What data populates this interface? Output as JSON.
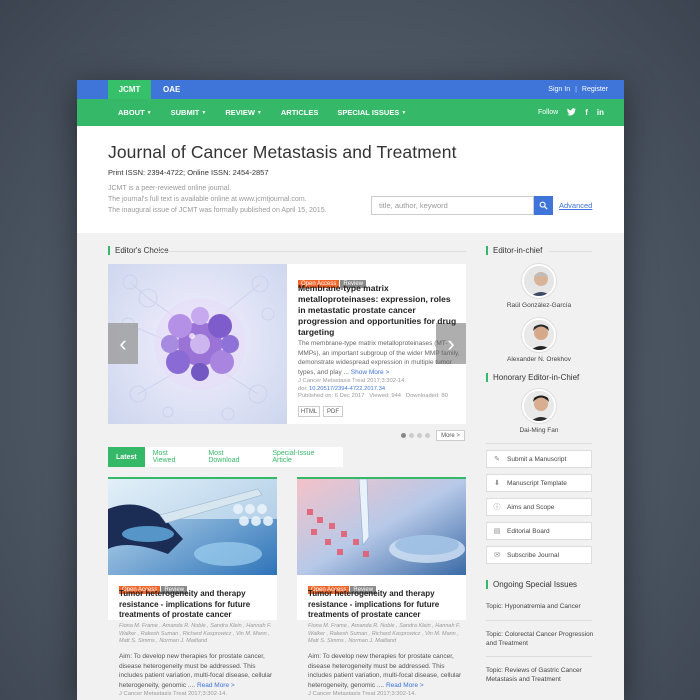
{
  "topbar": {
    "brand": "JCMT",
    "oae": "OAE",
    "signin": "Sign In",
    "sep": "|",
    "register": "Register"
  },
  "nav": {
    "items": [
      {
        "label": "ABOUT",
        "caret": true
      },
      {
        "label": "SUBMIT",
        "caret": true
      },
      {
        "label": "REVIEW",
        "caret": true
      },
      {
        "label": "ARTICLES",
        "caret": false
      },
      {
        "label": "SPECIAL ISSUES",
        "caret": true
      }
    ],
    "follow": "Follow"
  },
  "header": {
    "title": "Journal of Cancer Metastasis and Treatment",
    "issn": "Print ISSN: 2394-4722; Online ISSN: 2454-2857",
    "desc_lines": [
      "JCMT is a peer-reviewed online journal.",
      "The journal's full text is available online at www.jcmtjournal.com.",
      "The inaugural issue of JCMT was formally published on April 15, 2015."
    ],
    "search_placeholder": "title, author, keyword",
    "advanced": "Advanced"
  },
  "editors_choice": {
    "heading": "Editor's Choice",
    "tag_oa": "Open Access",
    "tag_review": "Review",
    "title": "Membrane-type matrix metalloproteinases: expression, roles in metastatic prostate cancer progression and opportunities for drug targeting",
    "abstract": "The membrane-type matrix metalloproteinases (MT-MMPs), an important subgroup of the wider MMP family, demonstrate widespread expression in multiple tumor types, and play ...",
    "show_more": "Show More >",
    "citation": "J Cancer Metastasis Treat 2017;3:302-14.",
    "doi_label": "doi:",
    "doi": "10.20517/2394-4722.2017.34",
    "published": "Published on: 6 Dec 2017",
    "viewed": "Viewed: 944",
    "downloaded": "Downloaded: 80",
    "html_btn": "HTML",
    "pdf_btn": "PDF",
    "more_btn": "More >",
    "prev": "‹",
    "next": "›"
  },
  "tabs": [
    "Latest",
    "Most Viewed",
    "Most Download",
    "Special-Issue Article"
  ],
  "cards": [
    {
      "tag_oa": "Open Access",
      "tag_review": "Review",
      "title": "Tumor heterogeneity and therapy resistance - implications for future treatments of prostate cancer",
      "authors": "Fiona M. Frame , Amanda R. Noble , Sandra Klein , Hannah F. Walker , Rakesh Suman , Richard Kasprowicz , Vin M. Mann , Matt S. Simms , Norman J. Maitland",
      "abstract": "Aim: To develop new therapies for prostate cancer, disease heterogeneity must be addressed. This includes patient variation, multi-focal disease, cellular heterogeneity, genomic ....",
      "read_more": "Read More >",
      "citation": "J Cancer Metastasis Treat 2017;3:302-14."
    },
    {
      "tag_oa": "Open Access",
      "tag_review": "Review",
      "title": "Tumor heterogeneity and therapy resistance - implications for future treatments of prostate cancer",
      "authors": "Fiona M. Frame , Amanda R. Noble , Sandra Klein , Hannah F. Walker , Rakesh Suman , Richard Kasprowicz , Vin M. Mann , Matt S. Simms , Norman J. Maitland",
      "abstract": "Aim: To develop new therapies for prostate cancer, disease heterogeneity must be addressed. This includes patient variation, multi-focal disease, cellular heterogeneity, genomic ....",
      "read_more": "Read More >",
      "citation": "J Cancer Metastasis Treat 2017;3:302-14."
    }
  ],
  "sidebar": {
    "editor_heading": "Editor-in-chief",
    "editors": [
      "Raúl González-García",
      "Alexander N. Orekhov"
    ],
    "honorary_heading": "Honorary Editor-in-Chief",
    "honorary": [
      "Dai-Ming Fan"
    ],
    "buttons": [
      {
        "label": "Submit a Manuscript",
        "icon": "pencil-icon",
        "glyph": "✎"
      },
      {
        "label": "Manuscript Template",
        "icon": "download-icon",
        "glyph": "⬇"
      },
      {
        "label": "Aims and Scope",
        "icon": "info-icon",
        "glyph": "ⓘ"
      },
      {
        "label": "Editorial Board",
        "icon": "board-icon",
        "glyph": "▤"
      },
      {
        "label": "Subscribe Journal",
        "icon": "mail-icon",
        "glyph": "✉"
      }
    ],
    "ongoing_heading": "Ongoing Special Issues",
    "ongoing": [
      "Topic: Hyponatremia and Cancer",
      "Topic: Colorectal Cancer Progression and Treatment",
      "Topic: Reviews of Gastric Cancer Metastasis and Treatment"
    ]
  },
  "colors": {
    "blue": "#3f74d9",
    "green": "#36b869",
    "orange": "#f0672c"
  }
}
